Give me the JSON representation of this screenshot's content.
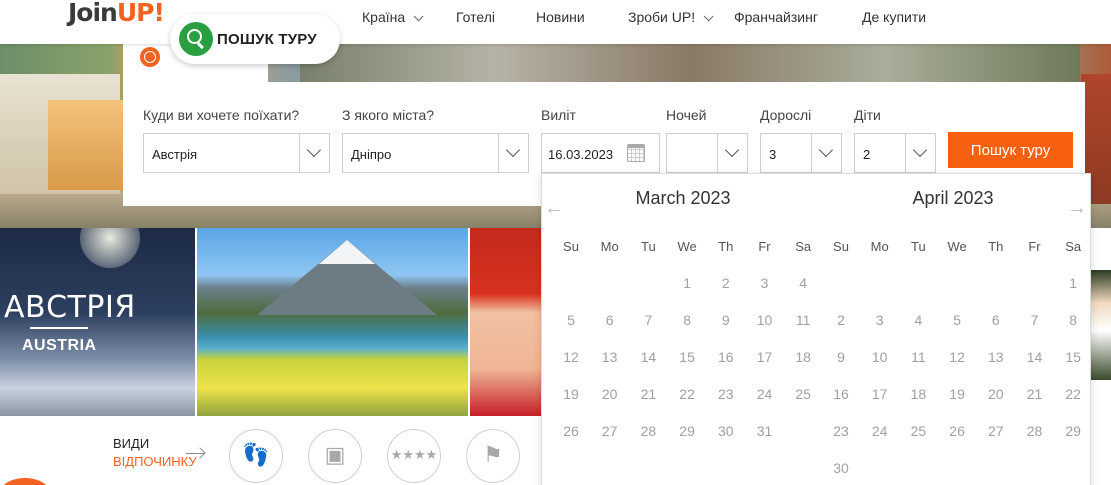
{
  "brand": {
    "logo_main": "Join",
    "logo_accent": "UP!"
  },
  "nav": {
    "items": [
      {
        "label": "Країна",
        "has_dropdown": true
      },
      {
        "label": "Готелі",
        "has_dropdown": false
      },
      {
        "label": "Новини",
        "has_dropdown": false
      },
      {
        "label": "Зроби UP!",
        "has_dropdown": true
      },
      {
        "label": "Франчайзинг",
        "has_dropdown": false
      },
      {
        "label": "Де купити",
        "has_dropdown": false
      }
    ]
  },
  "tour_search_pill": {
    "label": "ПОШУК ТУРУ",
    "icon": "search-icon"
  },
  "search_form": {
    "destination": {
      "label": "Куди ви хочете поїхати?",
      "value": "Австрія"
    },
    "departure": {
      "label": "З якого міста?",
      "value": "Дніпро"
    },
    "date": {
      "label": "Виліт",
      "value": "16.03.2023",
      "icon": "calendar-icon"
    },
    "nights": {
      "label": "Ночей",
      "value": ""
    },
    "adults": {
      "label": "Дорослі",
      "value": "3"
    },
    "children": {
      "label": "Діти",
      "value": "2"
    },
    "submit_label": "Пошук туру"
  },
  "calendar": {
    "prev": "←",
    "next": "→",
    "weekdays": [
      "Su",
      "Mo",
      "Tu",
      "We",
      "Th",
      "Fr",
      "Sa"
    ],
    "months": [
      {
        "title": "March 2023",
        "weeks": [
          [
            "",
            "",
            "",
            "1",
            "2",
            "3",
            "4"
          ],
          [
            "5",
            "6",
            "7",
            "8",
            "9",
            "10",
            "11"
          ],
          [
            "12",
            "13",
            "14",
            "15",
            "16",
            "17",
            "18"
          ],
          [
            "19",
            "20",
            "21",
            "22",
            "23",
            "24",
            "25"
          ],
          [
            "26",
            "27",
            "28",
            "29",
            "30",
            "31",
            ""
          ]
        ]
      },
      {
        "title": "April 2023",
        "weeks": [
          [
            "",
            "",
            "",
            "",
            "",
            "",
            "1"
          ],
          [
            "2",
            "3",
            "4",
            "5",
            "6",
            "7",
            "8"
          ],
          [
            "9",
            "10",
            "11",
            "12",
            "13",
            "14",
            "15"
          ],
          [
            "16",
            "17",
            "18",
            "19",
            "20",
            "21",
            "22"
          ],
          [
            "23",
            "24",
            "25",
            "26",
            "27",
            "28",
            "29"
          ],
          [
            "30",
            "",
            "",
            "",
            "",
            "",
            ""
          ]
        ]
      }
    ]
  },
  "tiles": {
    "austria": {
      "title": "АВСТРІЯ",
      "subtitle": "AUSTRIA"
    }
  },
  "vacation_types": {
    "label": "ВИДИ",
    "label_accent": "ВІДПОЧИНКУ",
    "icons": [
      "flip-flops-icon",
      "shopping-bag-icon",
      "stars-icon",
      "running-people-icon"
    ]
  },
  "colors": {
    "accent": "#f26322",
    "button": "#f7600f",
    "search_icon_bg": "#2a9f42"
  }
}
